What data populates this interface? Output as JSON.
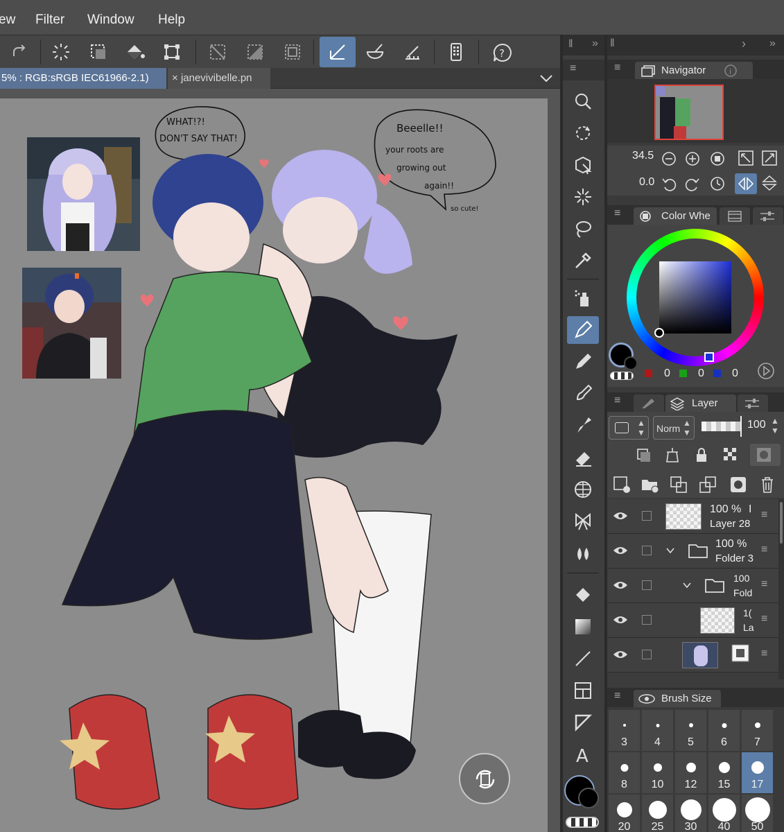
{
  "menu": {
    "items": [
      "ew",
      "Filter",
      "Window",
      "Help"
    ]
  },
  "toolbar": {
    "icons": [
      "redo-icon",
      "loading-spinner-icon",
      "select-all-icon",
      "fill-icon",
      "transform-icon",
      "deselect-icon",
      "invert-selection-icon",
      "marquee-icon",
      "ruler-snap-icon",
      "mortar-icon",
      "ruler-edit-icon",
      "tablet-icon",
      "help-icon"
    ],
    "active": "ruler-snap-icon"
  },
  "tabs": {
    "active_label": "5% : RGB:sRGB IEC61966-2.1)",
    "second_label": "janevivibelle.pn",
    "close_glyph": "×"
  },
  "artwork": {
    "bubble1": [
      "WHAT!?!",
      "DON'T SAY THAT!"
    ],
    "bubble2": [
      "Beeelle!!",
      "your roots are",
      "growing out",
      "again!!"
    ],
    "bubble2_tail": "so cute!"
  },
  "navigator": {
    "title": "Navigator",
    "zoom": "34.5",
    "rotation": "0.0"
  },
  "color_wheel": {
    "title": "Color Whe",
    "r": "0",
    "g": "0",
    "b": "0",
    "main_color": "#000000",
    "hue_color": "#1d2fd6"
  },
  "layer": {
    "title": "Layer",
    "blend_mode": "Norm",
    "opacity": "100",
    "rows": [
      {
        "opacity": "100 %",
        "suffix": "I",
        "name": "Layer 28"
      },
      {
        "opacity": "100 %",
        "name": "Folder 3"
      },
      {
        "opacity": "100",
        "name": "Fold"
      },
      {
        "opacity": "1(",
        "name": "La"
      }
    ]
  },
  "brush_size": {
    "title": "Brush Size",
    "sizes": [
      "3",
      "4",
      "5",
      "6",
      "7",
      "8",
      "10",
      "12",
      "15",
      "17",
      "20",
      "25",
      "30",
      "40",
      "50"
    ],
    "selected": "17"
  }
}
